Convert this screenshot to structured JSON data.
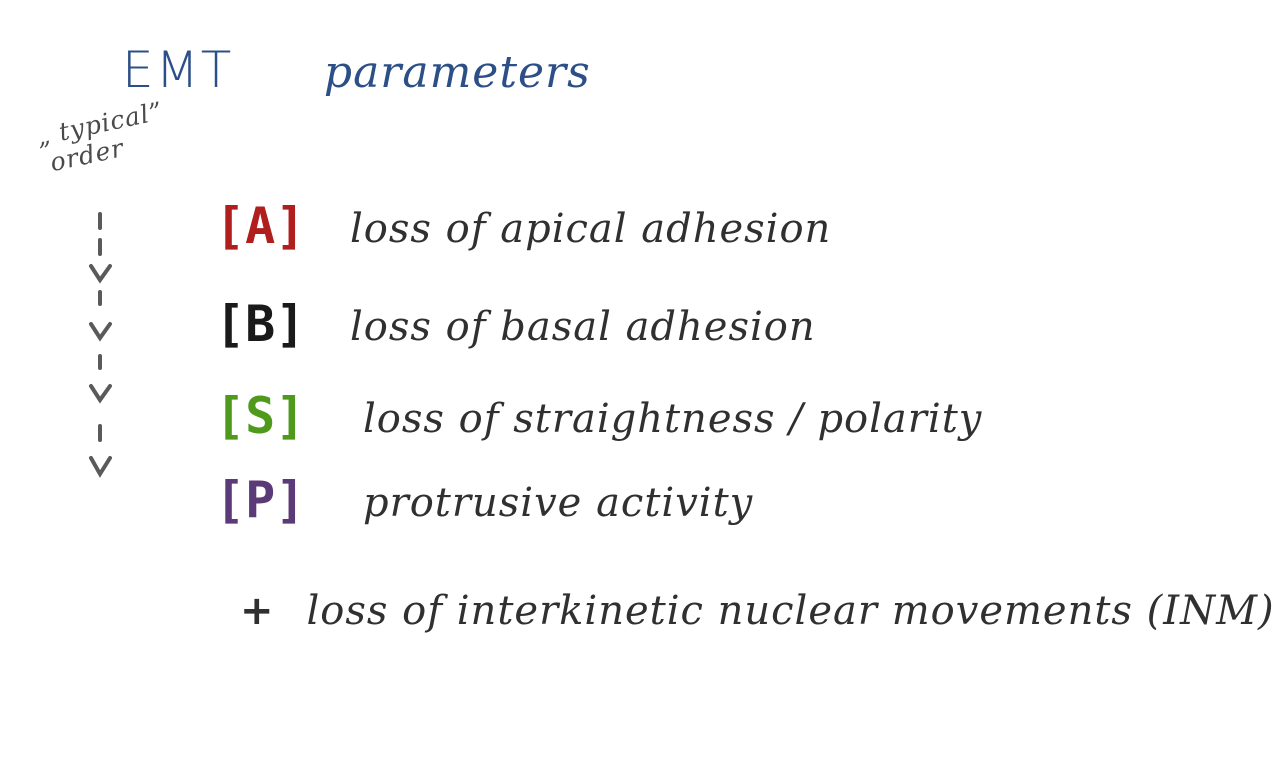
{
  "title": {
    "part1": "EMT",
    "part2": "parameters",
    "color": "#2b4f86"
  },
  "order_label": {
    "line1": "„ typical”",
    "line2": "order"
  },
  "parameters": [
    {
      "badge": "[A]",
      "description": "loss of apical adhesion",
      "color": "#b01e1e"
    },
    {
      "badge": "[B]",
      "description": "loss of basal adhesion",
      "color": "#1a1a1a"
    },
    {
      "badge": "[S]",
      "description": "loss of straightness / polarity",
      "color": "#4f9a1c"
    },
    {
      "badge": "[P]",
      "description": "protrusive activity",
      "color": "#5b3a78"
    }
  ],
  "extra": {
    "plus": "+",
    "text": "loss of interkinetic nuclear movements (INM)"
  },
  "arrow_color": "#5a5a5a"
}
